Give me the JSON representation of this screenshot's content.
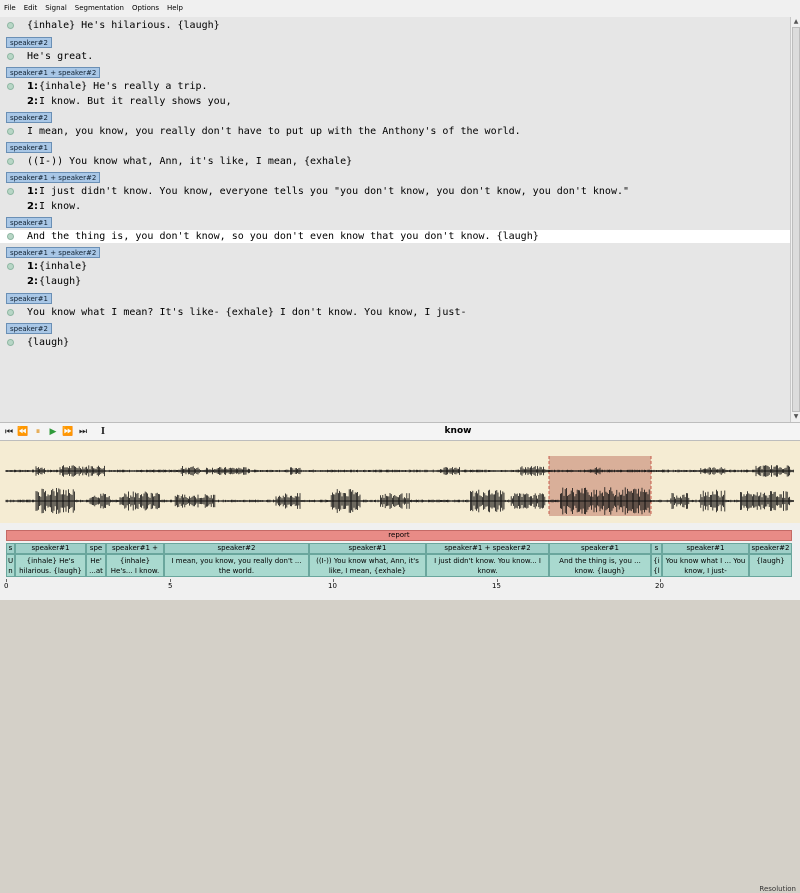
{
  "menu": [
    "File",
    "Edit",
    "Signal",
    "Segmentation",
    "Options",
    "Help"
  ],
  "transcript": [
    {
      "type": "line",
      "text": "{inhale} He's hilarious. {laugh}"
    },
    {
      "type": "tag",
      "label": "speaker#2"
    },
    {
      "type": "line",
      "text": "He's great."
    },
    {
      "type": "tag",
      "label": "speaker#1 + speaker#2"
    },
    {
      "type": "line",
      "num": "1:",
      "text": "{inhale} He's really a trip."
    },
    {
      "type": "line",
      "num": "2:",
      "text": "I know. But it really shows you,"
    },
    {
      "type": "tag",
      "label": "speaker#2"
    },
    {
      "type": "line",
      "text": "I mean, you know, you really don't have to put up with the Anthony's of the world."
    },
    {
      "type": "tag",
      "label": "speaker#1"
    },
    {
      "type": "line",
      "text": "((I-)) You know what, Ann, it's like, I mean, {exhale}"
    },
    {
      "type": "tag",
      "label": "speaker#1 + speaker#2"
    },
    {
      "type": "line",
      "num": "1:",
      "text": "I just didn't know. You know, everyone tells you \"you don't know, you don't know, you don't know.\""
    },
    {
      "type": "line",
      "num": "2:",
      "text": "I know."
    },
    {
      "type": "tag",
      "label": "speaker#1"
    },
    {
      "type": "line",
      "text": "And the thing is, you don't know, so you don't even know that you don't know. {laugh}",
      "highlight": true
    },
    {
      "type": "tag",
      "label": "speaker#1 + speaker#2"
    },
    {
      "type": "line",
      "num": "1:",
      "text": "{inhale}"
    },
    {
      "type": "line",
      "num": "2:",
      "text": "{laugh}"
    },
    {
      "type": "tag",
      "label": "speaker#1"
    },
    {
      "type": "line",
      "text": "You know what I mean? It's like- {exhale} I don't know. You know, I just-"
    },
    {
      "type": "tag",
      "label": "speaker#2"
    },
    {
      "type": "line",
      "text": "{laugh}"
    }
  ],
  "toolbar": {
    "current_word": "know",
    "resolution_label": "Resolution",
    "icons": [
      "skip-start-icon",
      "rewind-icon",
      "pause-icon",
      "play-icon",
      "fast-forward-icon",
      "skip-end-icon",
      "text-cursor-icon"
    ]
  },
  "annotation": {
    "report_label": "report",
    "segments": [
      {
        "head": "s",
        "body": "U n"
      },
      {
        "head": "speaker#1",
        "body": "{inhale} He's hilarious. {laugh}"
      },
      {
        "head": "spe",
        "body": "He' ...at"
      },
      {
        "head": "speaker#1 +",
        "body": "{inhale} He's... I know. But it..."
      },
      {
        "head": "speaker#2",
        "body": "I mean, you know, you really don't ... the world."
      },
      {
        "head": "speaker#1",
        "body": "((I-)) You know what, Ann, it's like, I mean, {exhale}"
      },
      {
        "head": "speaker#1 + speaker#2",
        "body": "I just didn't know. You know... I know."
      },
      {
        "head": "speaker#1",
        "body": "And the thing is, you ... know. {laugh}"
      },
      {
        "head": "s",
        "body": "{i {l"
      },
      {
        "head": "speaker#1",
        "body": "You know what I ... You know, I just-"
      },
      {
        "head": "speaker#2",
        "body": "{laugh}"
      }
    ],
    "timeline_ticks": [
      "0",
      "5",
      "10",
      "15",
      "20"
    ]
  },
  "colors": {
    "signal_bg": "#f5ecd3",
    "selection": "#d4a58e",
    "report": "#e88b86",
    "segment": "#a9d9cf",
    "speaker_tag": "#a9c7e6"
  }
}
